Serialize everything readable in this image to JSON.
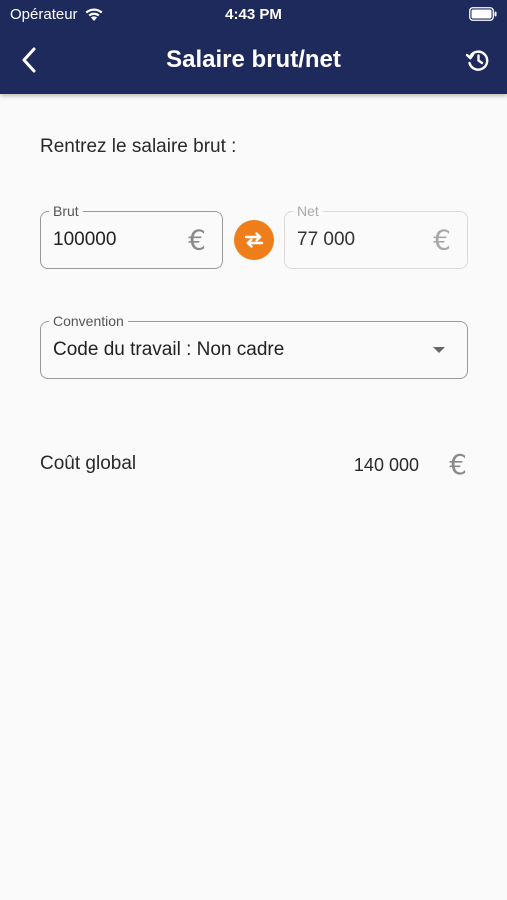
{
  "status_bar": {
    "carrier": "Opérateur",
    "time": "4:43 PM"
  },
  "header": {
    "title": "Salaire brut/net",
    "back_icon": "chevron-left-icon",
    "history_icon": "history-icon"
  },
  "form": {
    "instruction": "Rentrez le salaire brut :",
    "brut": {
      "label": "Brut",
      "value": "100000",
      "currency": "€"
    },
    "net": {
      "label": "Net",
      "value": "77 000",
      "currency": "€"
    },
    "convention": {
      "label": "Convention",
      "value": "Code du travail : Non cadre"
    }
  },
  "cost": {
    "label": "Coût global",
    "value": "140 000",
    "currency": "€"
  },
  "colors": {
    "header": "#1f2a5c",
    "accent": "#ef7d1a",
    "background": "#fafafa"
  }
}
